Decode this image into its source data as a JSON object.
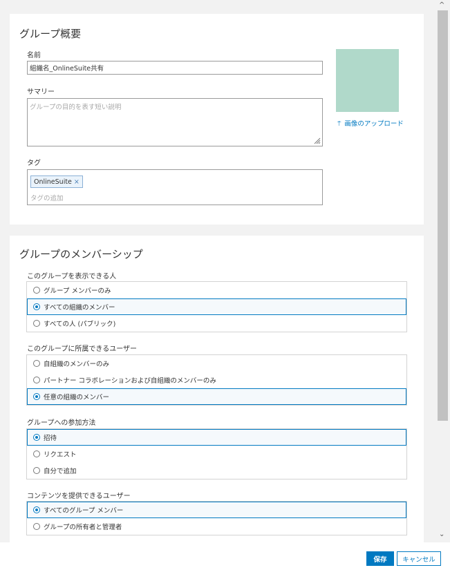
{
  "overview": {
    "title": "グループ概要",
    "name_label": "名前",
    "name_value": "組織名_OnlineSuite共有",
    "summary_label": "サマリー",
    "summary_placeholder": "グループの目的を表す短い説明",
    "tags_label": "タグ",
    "tags": [
      "OnlineSuite"
    ],
    "tag_remove_glyph": "×",
    "tag_add_placeholder": "タグの追加",
    "upload_icon": "⍑",
    "upload_label": "画像のアップロード"
  },
  "membership": {
    "title": "グループのメンバーシップ",
    "groups": [
      {
        "label": "このグループを表示できる人",
        "options": [
          {
            "label": "グループ メンバーのみ",
            "selected": false
          },
          {
            "label": "すべての組織のメンバー",
            "selected": true
          },
          {
            "label": "すべての人 (パブリック)",
            "selected": false
          }
        ]
      },
      {
        "label": "このグループに所属できるユーザー",
        "options": [
          {
            "label": "自組織のメンバーのみ",
            "selected": false
          },
          {
            "label": "パートナー コラボレーションおよび自組織のメンバーのみ",
            "selected": false
          },
          {
            "label": "任意の組織のメンバー",
            "selected": true
          }
        ]
      },
      {
        "label": "グループへの参加方法",
        "options": [
          {
            "label": "招待",
            "selected": true
          },
          {
            "label": "リクエスト",
            "selected": false
          },
          {
            "label": "自分で追加",
            "selected": false
          }
        ]
      },
      {
        "label": "コンテンツを提供できるユーザー",
        "options": [
          {
            "label": "すべてのグループ メンバー",
            "selected": true
          },
          {
            "label": "グループの所有者と管理者",
            "selected": false
          }
        ]
      }
    ]
  },
  "footer": {
    "save_label": "保存",
    "cancel_label": "キャンセル"
  },
  "scrollbar": {
    "up_glyph": "^",
    "down_glyph": "⌄"
  },
  "colors": {
    "accent": "#0079c1",
    "thumbnail": "#b0d9ca",
    "selected_bg": "#f5f9fc"
  }
}
